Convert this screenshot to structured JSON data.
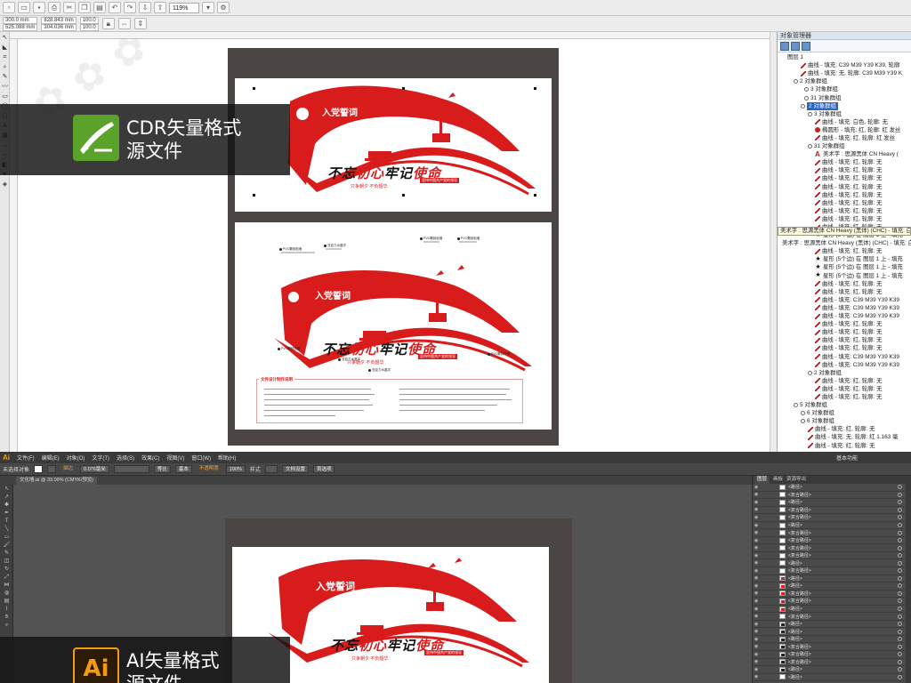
{
  "cdr": {
    "propbar": {
      "x": "300.0 mm",
      "y": "525.088 mm",
      "width": "828.843 mm",
      "height": "304.036 mm",
      "scale_x": "100.0",
      "scale_y": "100.0",
      "zoom": "119%"
    },
    "object_manager": {
      "title": "对象管理器",
      "rows": [
        {
          "label": "图层 1",
          "icon": "none",
          "indent": 6
        },
        {
          "label": "曲线 - 填充: C39 M39 Y39 K39, 轮廓",
          "icon": "curve",
          "indent": 26
        },
        {
          "label": "曲线 - 填充: 无, 轮廓: C39 M39 Y39 K",
          "icon": "curve",
          "indent": 26
        },
        {
          "label": "2 对象群组",
          "icon": "group",
          "indent": 18
        },
        {
          "label": "3 对象群组",
          "icon": "group",
          "indent": 30
        },
        {
          "label": "31 对象群组",
          "icon": "group",
          "indent": 30
        },
        {
          "label": "2 对象群组",
          "icon": "group",
          "indent": 26,
          "selected": true
        },
        {
          "label": "3 对象群组",
          "icon": "group",
          "indent": 34
        },
        {
          "label": "曲线 - 填充: 白色, 轮廓: 无",
          "icon": "curve",
          "indent": 42
        },
        {
          "label": "椭圆形 - 填充: 红, 轮廓: 红 发丝",
          "icon": "ellipse",
          "indent": 42
        },
        {
          "label": "曲线 - 填充: 红, 轮廓: 红 发丝",
          "icon": "curve",
          "indent": 42
        },
        {
          "label": "31 对象群组",
          "icon": "group",
          "indent": 34
        },
        {
          "label": "美术字 : 思源黑体 CN Heavy (",
          "icon": "text",
          "indent": 42
        },
        {
          "label": "曲线 - 填充: 红, 轮廓: 无",
          "icon": "curve",
          "indent": 42
        },
        {
          "label": "曲线 - 填充: 红, 轮廓: 无",
          "icon": "curve",
          "indent": 42
        },
        {
          "label": "曲线 - 填充: 红, 轮廓: 无",
          "icon": "curve",
          "indent": 42
        },
        {
          "label": "曲线 - 填充: 红, 轮廓: 无",
          "icon": "curve",
          "indent": 42
        },
        {
          "label": "曲线 - 填充: 红, 轮廓: 无",
          "icon": "curve",
          "indent": 42
        },
        {
          "label": "曲线 - 填充: 红, 轮廓: 无",
          "icon": "curve",
          "indent": 42
        },
        {
          "label": "曲线 - 填充: 红, 轮廓: 无",
          "icon": "curve",
          "indent": 42
        },
        {
          "label": "曲线 - 填充: 红, 轮廓: 无",
          "icon": "curve",
          "indent": 42
        },
        {
          "label": "曲线 - 填充: 红, 轮廓: 无",
          "icon": "curve",
          "indent": 42
        },
        {
          "label": "星形 (5个边) 在 图层 1 上 - 填充",
          "icon": "star",
          "indent": 42
        },
        {
          "label": "美术字 : 思源黑体 CN Heavy (黑体) (CHC) - 填充: 白",
          "icon": "none",
          "indent": 0
        },
        {
          "label": "曲线 - 填充: 红, 轮廓: 无",
          "icon": "curve",
          "indent": 42
        },
        {
          "label": "星形 (5个边) 在 图层 1 上 - 填充",
          "icon": "star",
          "indent": 42
        },
        {
          "label": "星形 (5个边) 在 图层 1 上 - 填充",
          "icon": "star",
          "indent": 42
        },
        {
          "label": "星形 (5个边) 在 图层 1 上 - 填充",
          "icon": "star",
          "indent": 42
        },
        {
          "label": "曲线 - 填充: 红, 轮廓: 无",
          "icon": "curve",
          "indent": 42
        },
        {
          "label": "曲线 - 填充: 红, 轮廓: 无",
          "icon": "curve",
          "indent": 42
        },
        {
          "label": "曲线 - 填充: C39 M39 Y39 K39",
          "icon": "curve",
          "indent": 42
        },
        {
          "label": "曲线 - 填充: C39 M39 Y39 K39",
          "icon": "curve",
          "indent": 42
        },
        {
          "label": "曲线 - 填充: C39 M39 Y39 K39",
          "icon": "curve",
          "indent": 42
        },
        {
          "label": "曲线 - 填充: 红, 轮廓: 无",
          "icon": "curve",
          "indent": 42
        },
        {
          "label": "曲线 - 填充: 红, 轮廓: 无",
          "icon": "curve",
          "indent": 42
        },
        {
          "label": "曲线 - 填充: 红, 轮廓: 无",
          "icon": "curve",
          "indent": 42
        },
        {
          "label": "曲线 - 填充: 红, 轮廓: 无",
          "icon": "curve",
          "indent": 42
        },
        {
          "label": "曲线 - 填充: C39 M39 Y39 K39",
          "icon": "curve",
          "indent": 42
        },
        {
          "label": "曲线 - 填充: C39 M39 Y39 K39",
          "icon": "curve",
          "indent": 42
        },
        {
          "label": "2 对象群组",
          "icon": "group",
          "indent": 34
        },
        {
          "label": "曲线 - 填充: 红, 轮廓: 无",
          "icon": "curve",
          "indent": 42
        },
        {
          "label": "曲线 - 填充: 红, 轮廓: 无",
          "icon": "curve",
          "indent": 42
        },
        {
          "label": "曲线 - 填充: 红, 轮廓: 无",
          "icon": "curve",
          "indent": 42
        },
        {
          "label": "5 对象群组",
          "icon": "group",
          "indent": 18
        },
        {
          "label": "6 对象群组",
          "icon": "group",
          "indent": 26
        },
        {
          "label": "6 对象群组",
          "icon": "group",
          "indent": 26
        },
        {
          "label": "曲线 - 填充: 红, 轮廓: 无",
          "icon": "curve",
          "indent": 34
        },
        {
          "label": "曲线 - 填充: 无, 轮廓: 红 1.163 毫",
          "icon": "curve",
          "indent": 34
        },
        {
          "label": "曲线 - 填充: 红, 轮廓: 无",
          "icon": "curve",
          "indent": 34
        }
      ],
      "tooltip": "美术字 : 思源黑体 CN Heavy (黑体) (CHC) - 填充: 白, 轮"
    }
  },
  "design": {
    "oath_title": "入党誓词",
    "slogan_part1": "不忘",
    "slogan_part2": "初心",
    "slogan_part3": "牢记",
    "slogan_part4": "使命",
    "sub_slogan": "只争朝夕 不负韶华",
    "banner_tag": "坚持中国共产党的领导",
    "callouts": [
      "PVC雕刻贴墙",
      "亚克力水晶字",
      "PVC雕刻贴墙",
      "PVC雕刻贴墙",
      "PVC雕刻贴墙",
      "亚克力水晶字",
      "亚克力水晶字",
      "PVC雕刻贴墙"
    ],
    "notes_title": "文件设计制作说明"
  },
  "ai": {
    "menu": [
      "文件(F)",
      "编辑(E)",
      "对象(O)",
      "文字(T)",
      "选择(S)",
      "效果(C)",
      "视图(V)",
      "窗口(W)",
      "帮助(H)"
    ],
    "workspace": "基本功能",
    "ctrl": {
      "no_selection": "未选择对象",
      "stroke_label": "描边",
      "stroke_value": "0.076毫米",
      "uniform": "等比",
      "brush": "基本",
      "opacity_label": "不透明度",
      "opacity_value": "100%",
      "style_label": "样式",
      "doc_setup": "文档设置",
      "prefs": "首选项"
    },
    "tab": "文化墙.ai @ 33.09% (CMYK/预览)",
    "layers_tabs": [
      "图层",
      "画板",
      "资源导出"
    ],
    "layers": [
      {
        "name": "<路径>",
        "thumb": "white"
      },
      {
        "name": "<复合路径>",
        "thumb": "white"
      },
      {
        "name": "<路径>",
        "thumb": "white"
      },
      {
        "name": "<复合路径>",
        "thumb": "white"
      },
      {
        "name": "<复合路径>",
        "thumb": "white"
      },
      {
        "name": "<路径>",
        "thumb": "white"
      },
      {
        "name": "<复合路径>",
        "thumb": "white"
      },
      {
        "name": "<复合路径>",
        "thumb": "white"
      },
      {
        "name": "<复合路径>",
        "thumb": "white"
      },
      {
        "name": "<复合路径>",
        "thumb": "white"
      },
      {
        "name": "<路径>",
        "thumb": "white"
      },
      {
        "name": "<复合路径>",
        "thumb": "white"
      },
      {
        "name": "<路径>",
        "thumb": "red"
      },
      {
        "name": "<路径>",
        "thumb": "red"
      },
      {
        "name": "<复合路径>",
        "thumb": "red"
      },
      {
        "name": "<复合路径>",
        "thumb": "red"
      },
      {
        "name": "<路径>",
        "thumb": "red"
      },
      {
        "name": "<复合路径>",
        "thumb": "white"
      },
      {
        "name": "<路径>",
        "thumb": "dark"
      },
      {
        "name": "<路径>",
        "thumb": "dark"
      },
      {
        "name": "<路径>",
        "thumb": "dark"
      },
      {
        "name": "<复合路径>",
        "thumb": "dark"
      },
      {
        "name": "<复合路径>",
        "thumb": "dark"
      },
      {
        "name": "<复合路径>",
        "thumb": "dark"
      },
      {
        "name": "<路径>",
        "thumb": "dark"
      },
      {
        "name": "<路径>",
        "thumb": "white"
      }
    ]
  },
  "overlays": {
    "cdr_line1": "CDR矢量格式",
    "cdr_line2": "源文件",
    "ai_line1": "AI矢量格式",
    "ai_line2": "源文件"
  },
  "colors": {
    "brand_red": "#d81c1c",
    "cdr_green": "#5aa22a",
    "ai_orange": "#f29b13"
  }
}
